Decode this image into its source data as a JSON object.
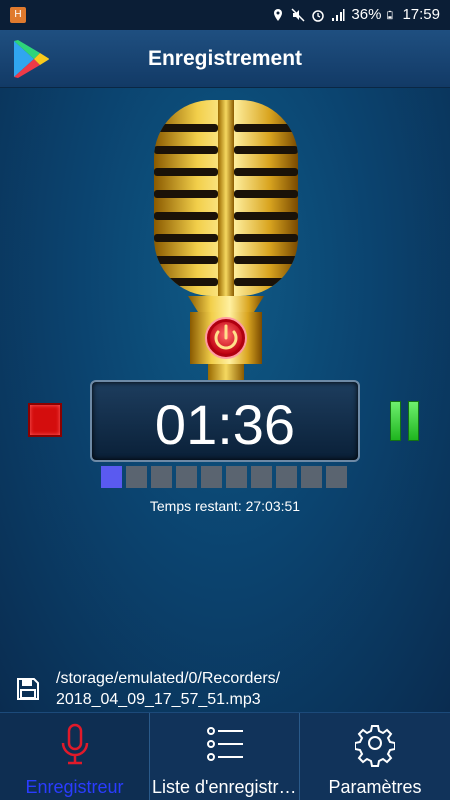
{
  "status_bar": {
    "battery": "36%",
    "time": "17:59",
    "notification_icon": "app-notification-icon",
    "icons": [
      "location-icon",
      "mute-icon",
      "alarm-icon",
      "signal-icon",
      "battery-icon"
    ]
  },
  "app_bar": {
    "title": "Enregistrement",
    "icon": "play-store-icon"
  },
  "recorder": {
    "timer": "01:36",
    "remaining": "Temps restant: 27:03:51",
    "level": {
      "active_segments": 1,
      "total_segments": 10
    },
    "colors": {
      "stop": "#d40d0d",
      "pause": "#2ecf2e",
      "level_on": "#5a5af0",
      "level_off": "#5a6470",
      "mic_gold": "#e0b020"
    }
  },
  "file": {
    "line1": "/storage/emulated/0/Recorders/",
    "line2": "2018_04_09_17_57_51.mp3",
    "icon": "save-icon"
  },
  "bottom_nav": {
    "items": [
      {
        "label": "Enregistreur",
        "icon": "microphone-icon",
        "active": true
      },
      {
        "label": "Liste d'enregistrements",
        "icon": "list-icon",
        "active": false
      },
      {
        "label": "Paramètres",
        "icon": "gear-icon",
        "active": false
      }
    ],
    "active_color": "#2a3cff"
  }
}
